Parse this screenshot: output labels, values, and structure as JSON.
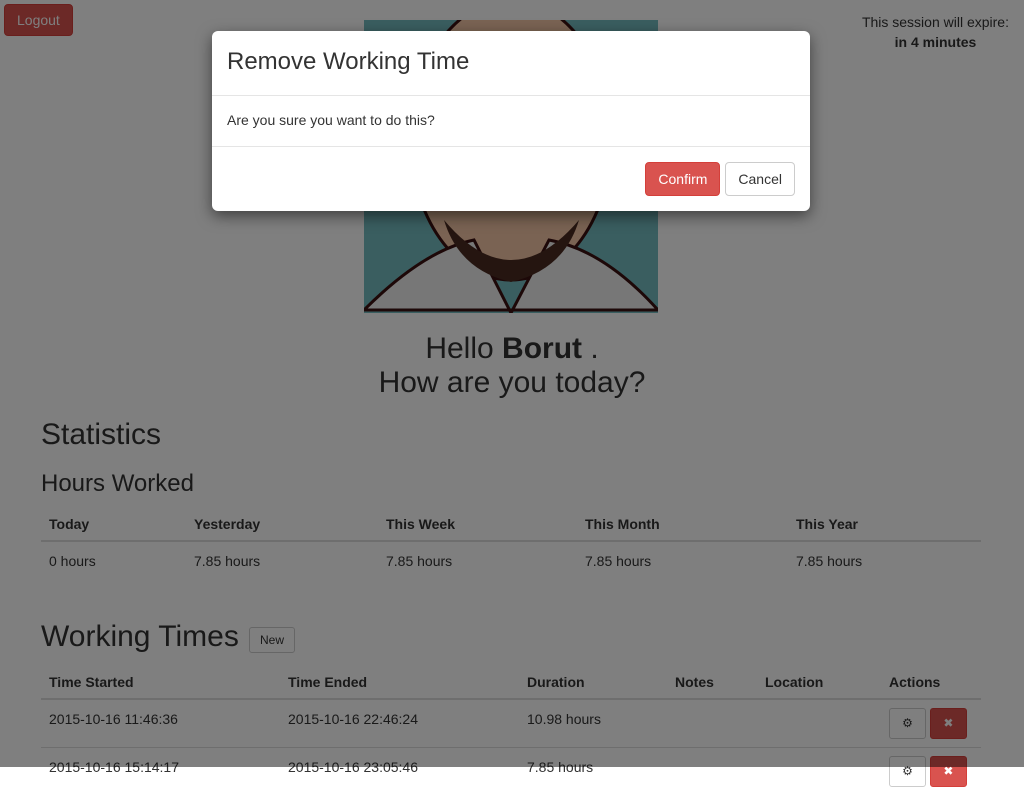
{
  "header": {
    "logout_label": "Logout",
    "session_text": "This session will expire:",
    "session_time": "in 4 minutes"
  },
  "greeting": {
    "hello": "Hello",
    "name": "Borut",
    "suffix": " .",
    "question": "How are you today?"
  },
  "statistics": {
    "title": "Statistics",
    "subtitle": "Hours Worked",
    "columns": [
      "Today",
      "Yesterday",
      "This Week",
      "This Month",
      "This Year"
    ],
    "values": [
      "0 hours",
      "7.85 hours",
      "7.85 hours",
      "7.85 hours",
      "7.85 hours"
    ]
  },
  "working_times": {
    "title": "Working Times",
    "new_label": "New",
    "columns": [
      "Time Started",
      "Time Ended",
      "Duration",
      "Notes",
      "Location",
      "Actions"
    ],
    "rows": [
      {
        "started": "2015-10-16 11:46:36",
        "ended": "2015-10-16 22:46:24",
        "duration": "10.98 hours",
        "notes": "",
        "location": ""
      },
      {
        "started": "2015-10-16 15:14:17",
        "ended": "2015-10-16 23:05:46",
        "duration": "7.85 hours",
        "notes": "",
        "location": ""
      }
    ],
    "edit_icon": "gear-icon",
    "delete_icon": "x-icon"
  },
  "modal": {
    "title": "Remove Working Time",
    "body": "Are you sure you want to do this?",
    "confirm_label": "Confirm",
    "cancel_label": "Cancel"
  }
}
